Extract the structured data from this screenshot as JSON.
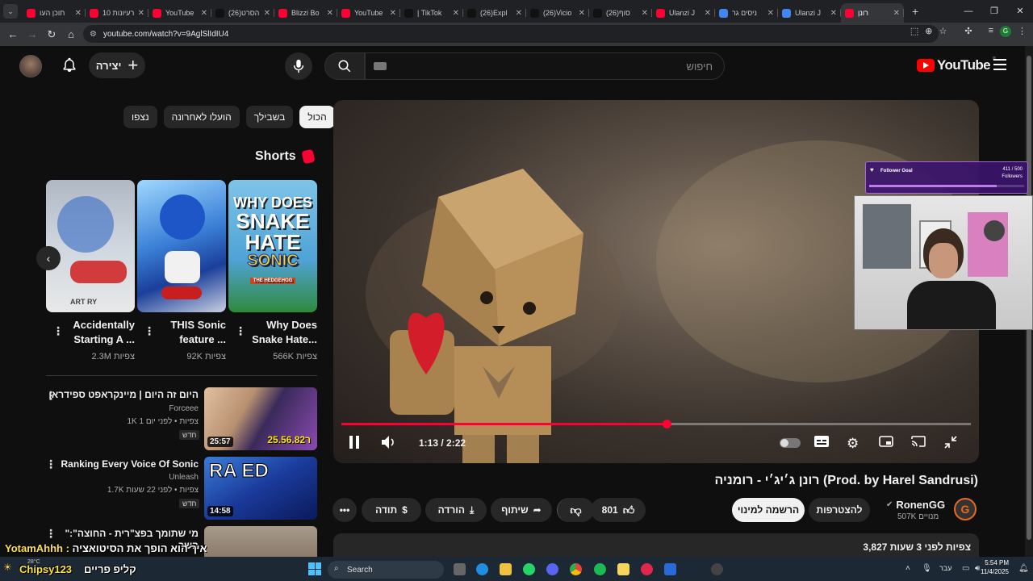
{
  "browser": {
    "tabs": [
      {
        "label": "תוכן העו",
        "favicon": "#ff0033"
      },
      {
        "label": "10 רעיונות",
        "favicon": "#ff0033"
      },
      {
        "label": "YouTube",
        "favicon": "#ff0033"
      },
      {
        "label": "(26)הסרט",
        "favicon": "#111111"
      },
      {
        "label": "Blizzi Bo",
        "favicon": "#ff0033"
      },
      {
        "label": "YouTube",
        "favicon": "#ff0033"
      },
      {
        "label": "| TikTok",
        "favicon": "#111111"
      },
      {
        "label": "(26)Expl",
        "favicon": "#111111"
      },
      {
        "label": "(26)Vicio",
        "favicon": "#111111"
      },
      {
        "label": "(26)סוף",
        "favicon": "#111111"
      },
      {
        "label": "Ulanzi J",
        "favicon": "#ff0033"
      },
      {
        "label": "ניסים גר",
        "favicon": "#4285f4"
      },
      {
        "label": "Ulanzi J",
        "favicon": "#4285f4"
      },
      {
        "label": "רונן",
        "favicon": "#ff0033",
        "active": true
      }
    ],
    "url": "youtube.com/watch?v=9AglSlIdIU4"
  },
  "youtube": {
    "create_label": "יצירה",
    "search_placeholder": "חיפוש",
    "logo_text": "YouTube",
    "logo_country": "IL",
    "chips": [
      "הכול",
      "בשבילך",
      "הועלו לאחרונה",
      "נצפו"
    ],
    "shorts_heading": "Shorts",
    "shorts": [
      {
        "title": "Accidentally Starting A ...",
        "views": "2.3M צפיות",
        "thumb_text": "ART RY"
      },
      {
        "title": "THIS Sonic feature ...",
        "views": "92K צפיות",
        "thumb_text": ""
      },
      {
        "title": "Why Does Snake Hate...",
        "views": "566K צפיות",
        "thumb_lines": [
          "WHY DOES",
          "SNAKE",
          "HATE",
          "SONIC",
          "THE HEDGEHOG"
        ]
      }
    ],
    "recommendations": [
      {
        "title": "היום זה היום | מיינקראפט ספידראן",
        "channel": "Forceee",
        "meta": "1K צפיות • לפני יום 1",
        "badge": "חדש",
        "duration": "25:57",
        "thumb_text": "25.56.82ר"
      },
      {
        "title": "Ranking Every Voice Of Sonic",
        "channel": "Unleash",
        "meta": "1.7K צפיות • לפני 22 שעות",
        "badge": "חדש",
        "duration": "14:58",
        "thumb_text": "RA ED"
      },
      {
        "title": "\"מי שתומך בפצ\"רית - החוצה\": השר",
        "channel": "",
        "meta": "",
        "badge": "",
        "duration": ""
      }
    ],
    "player": {
      "time": "1:13 / 2:22",
      "progress": 0.517
    },
    "video_title": "רונן ג׳יג׳י - רומניה (Prod. by Harel Sandrusi)",
    "channel_name": "RonenGG",
    "subscribers": "507K מנויים",
    "join_label": "להצטרפות",
    "subscribe_label": "הרשמה למינוי",
    "likes": "801",
    "share_label": "שיתוף",
    "download_label": "הורדה",
    "thanks_label": "תודה",
    "description_meta": "3,827 צפיות  לפני 3 שעות"
  },
  "stream_overlay": {
    "goal_label": "Follower Goal",
    "goal_count": "411 / 500",
    "goal_unit": "Followers",
    "goal_fraction": 0.822,
    "chat": [
      {
        "user": "YotamAhhh",
        "text": "איך הוא הופך את הסיטואציה"
      },
      {
        "user": "Chipsy123",
        "text": "קליפ פריים"
      }
    ]
  },
  "taskbar": {
    "weather": "28°C",
    "search_label": "Search",
    "lang": "עבר",
    "time": "5:54 PM",
    "date": "11/4/2025"
  }
}
